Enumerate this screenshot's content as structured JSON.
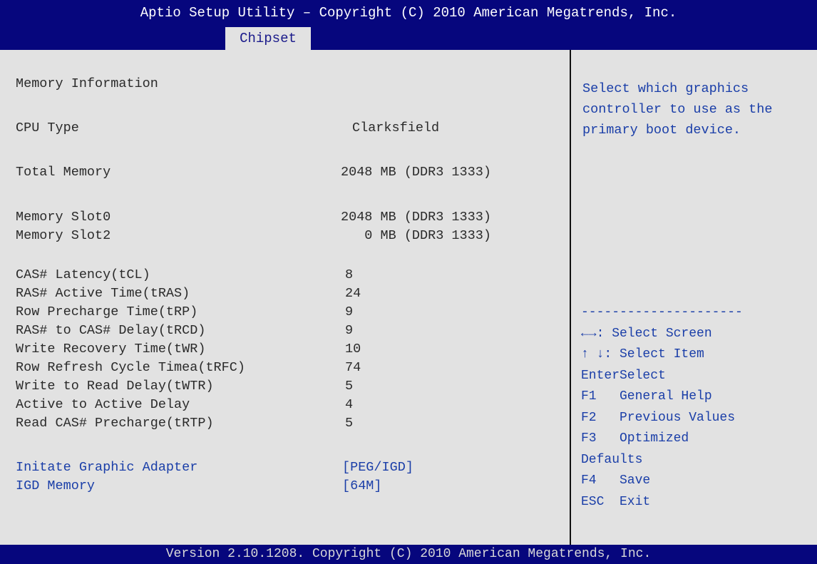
{
  "header": {
    "title": "Aptio Setup Utility – Copyright (C) 2010 American Megatrends, Inc.",
    "active_tab": "Chipset"
  },
  "main": {
    "section_title": "Memory Information",
    "info": [
      {
        "label": "CPU Type",
        "value": "Clarksfield"
      },
      {
        "label": "Total Memory",
        "value": "2048 MB (DDR3 1333)"
      },
      {
        "label": "Memory Slot0",
        "value": "2048 MB (DDR3 1333)"
      },
      {
        "label": "Memory Slot2",
        "value": "   0 MB (DDR3 1333)"
      }
    ],
    "timings": [
      {
        "label": "CAS# Latency(tCL)",
        "value": "8"
      },
      {
        "label": "RAS# Active Time(tRAS)",
        "value": "24"
      },
      {
        "label": "Row Precharge Time(tRP)",
        "value": "9"
      },
      {
        "label": "RAS# to CAS# Delay(tRCD)",
        "value": "9"
      },
      {
        "label": "Write Recovery Time(tWR)",
        "value": "10"
      },
      {
        "label": "Row Refresh Cycle Timea(tRFC)",
        "value": "74"
      },
      {
        "label": "Write to Read Delay(tWTR)",
        "value": "5"
      },
      {
        "label": "Active to Active Delay",
        "value": "4"
      },
      {
        "label": "Read CAS# Precharge(tRTP)",
        "value": "5"
      }
    ],
    "options": [
      {
        "label": "Initate Graphic Adapter",
        "value": "[PEG/IGD]"
      },
      {
        "label": "IGD Memory",
        "value": "[64M]"
      }
    ]
  },
  "help": {
    "description": "Select which graphics\ncontroller to use as the\nprimary boot device.",
    "separator": "---------------------",
    "keys": [
      "←→: Select Screen",
      "↑ ↓: Select Item",
      "EnterSelect",
      "F1   General Help",
      "F2   Previous Values",
      "F3   Optimized",
      "Defaults",
      "F4   Save",
      "ESC  Exit"
    ]
  },
  "footer": {
    "text": "Version 2.10.1208. Copyright (C) 2010 American Megatrends, Inc."
  },
  "colors": {
    "header_bg": "#06067d",
    "panel_bg": "#e2e2e2",
    "highlight_text": "#1a3ea8"
  }
}
